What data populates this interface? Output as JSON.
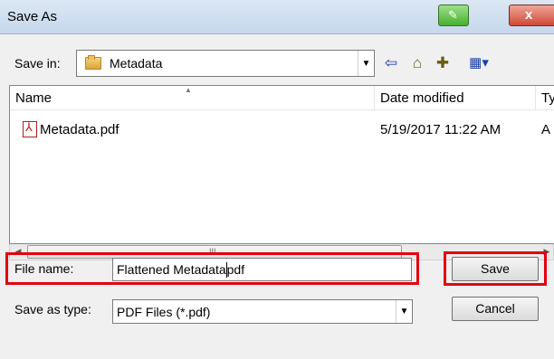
{
  "window": {
    "title": "Save As",
    "close_glyph": "x"
  },
  "save_in": {
    "label": "Save in:",
    "folder": "Metadata"
  },
  "toolbar": {
    "icons": [
      "back-icon",
      "up-folder-icon",
      "new-folder-icon",
      "view-menu-icon"
    ]
  },
  "file_list": {
    "columns": [
      "Name",
      "Date modified",
      "Ty"
    ],
    "rows": [
      {
        "name": "Metadata.pdf",
        "date_modified": "5/19/2017 11:22 AM",
        "type": "A"
      }
    ]
  },
  "scrollbar": {
    "grip": "III"
  },
  "file_name": {
    "label": "File name:",
    "value_before_caret": "Flattened Metadata",
    "value_after_caret": "pdf"
  },
  "save_as_type": {
    "label": "Save as type:",
    "value": "PDF Files (*.pdf)"
  },
  "buttons": {
    "save": "Save",
    "cancel": "Cancel"
  },
  "colors": {
    "highlight": "#e3000f"
  }
}
